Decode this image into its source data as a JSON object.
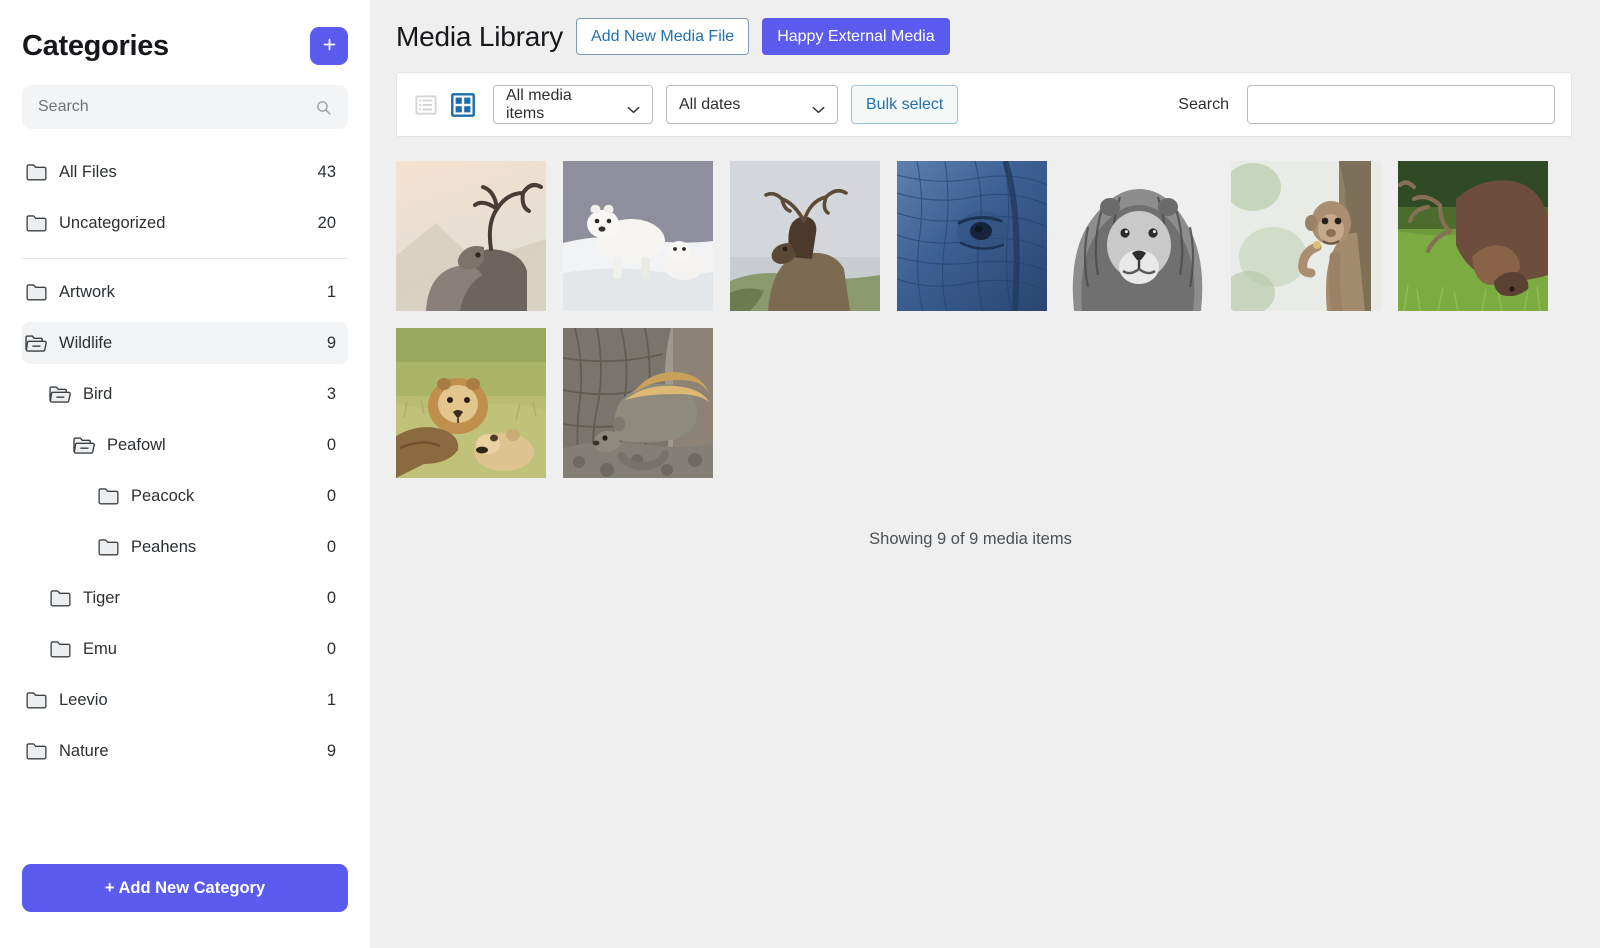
{
  "sidebar": {
    "title": "Categories",
    "add_button_label": "+",
    "add_button_icon": "plus-icon",
    "search": {
      "placeholder": "Search",
      "value": "",
      "icon": "search-icon"
    },
    "primary_items": [
      {
        "label": "All Files",
        "count": "43",
        "icon": "folder-closed-icon",
        "depth": 0,
        "selected": false
      },
      {
        "label": "Uncategorized",
        "count": "20",
        "icon": "folder-closed-icon",
        "depth": 0,
        "selected": false
      }
    ],
    "tree_items": [
      {
        "label": "Artwork",
        "count": "1",
        "icon": "folder-closed-icon",
        "depth": 0,
        "selected": false
      },
      {
        "label": "Wildlife",
        "count": "9",
        "icon": "folder-open-icon",
        "depth": 0,
        "selected": true
      },
      {
        "label": "Bird",
        "count": "3",
        "icon": "folder-open-icon",
        "depth": 1,
        "selected": false
      },
      {
        "label": "Peafowl",
        "count": "0",
        "icon": "folder-open-icon",
        "depth": 2,
        "selected": false
      },
      {
        "label": "Peacock",
        "count": "0",
        "icon": "folder-closed-icon",
        "depth": 3,
        "selected": false
      },
      {
        "label": "Peahens",
        "count": "0",
        "icon": "folder-closed-icon",
        "depth": 3,
        "selected": false
      },
      {
        "label": "Tiger",
        "count": "0",
        "icon": "folder-closed-icon",
        "depth": 1,
        "selected": false
      },
      {
        "label": "Emu",
        "count": "0",
        "icon": "folder-closed-icon",
        "depth": 1,
        "selected": false
      },
      {
        "label": "Leevio",
        "count": "1",
        "icon": "folder-closed-icon",
        "depth": 0,
        "selected": false
      },
      {
        "label": "Nature",
        "count": "9",
        "icon": "folder-closed-icon",
        "depth": 0,
        "selected": false
      }
    ],
    "add_category_label": "+ Add New Category"
  },
  "header": {
    "title": "Media Library",
    "add_media_label": "Add New Media File",
    "external_media_label": "Happy External Media"
  },
  "toolbar": {
    "list_view_icon": "list-view-icon",
    "grid_view_icon": "grid-view-icon",
    "active_view": "grid",
    "media_filter": {
      "value": "All media items",
      "icon": "chevron-down-icon"
    },
    "date_filter": {
      "value": "All dates",
      "icon": "chevron-down-icon"
    },
    "bulk_select_label": "Bulk select",
    "search_label": "Search",
    "search_value": "",
    "search_placeholder": ""
  },
  "media": {
    "items": [
      {
        "alt": "Red deer stag at sunset",
        "theme": "stag-sunset"
      },
      {
        "alt": "Polar bears on snow",
        "theme": "polar-bear"
      },
      {
        "alt": "Elk on ridge",
        "theme": "elk-gray"
      },
      {
        "alt": "Elephant eye close up",
        "theme": "elephant-blue"
      },
      {
        "alt": "Lion portrait black and white",
        "theme": "lion-bw"
      },
      {
        "alt": "Baby monkey on tree",
        "theme": "monkey"
      },
      {
        "alt": "Stag grazing in grass",
        "theme": "stag-grass"
      },
      {
        "alt": "Lions resting in grass",
        "theme": "lions-grass"
      },
      {
        "alt": "Squirrel beside tree trunk",
        "theme": "squirrel"
      }
    ],
    "showing_text": "Showing 9 of 9 media items"
  },
  "colors": {
    "accent_purple": "#5b5bf0",
    "link_blue": "#2271b1",
    "sidebar_bg": "#ffffff",
    "main_bg": "#efefef",
    "selected_row": "#f2f3f4"
  }
}
